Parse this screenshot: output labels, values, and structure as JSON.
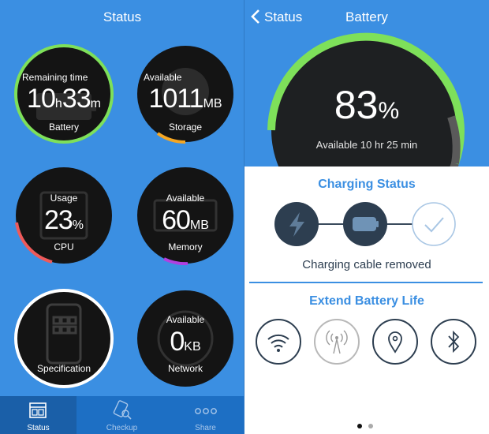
{
  "left_title": "Status",
  "nav": {
    "back_label": "Status",
    "title": "Battery"
  },
  "battery_tile": {
    "label": "Remaining time",
    "hours": "10",
    "h_unit": "h",
    "minutes": "33",
    "m_unit": "m",
    "name": "Battery"
  },
  "storage_tile": {
    "label": "Available",
    "value": "1011",
    "unit": "MB",
    "name": "Storage"
  },
  "cpu_tile": {
    "label": "Usage",
    "value": "23",
    "unit": "%",
    "name": "CPU"
  },
  "memory_tile": {
    "label": "Available",
    "value": "60",
    "unit": "MB",
    "name": "Memory"
  },
  "spec_tile": {
    "name": "Specification"
  },
  "network_tile": {
    "label": "Available",
    "value": "0",
    "unit": "KB",
    "name": "Network"
  },
  "tabs": [
    {
      "label": "Status",
      "icon": "status-icon"
    },
    {
      "label": "Checkup",
      "icon": "checkup-icon"
    },
    {
      "label": "Share",
      "icon": "share-icon"
    }
  ],
  "battery_big": {
    "percent": "83",
    "unit": "%",
    "available": "Available 10 hr 25 min",
    "level": 0.83
  },
  "charging": {
    "title": "Charging Status",
    "status": "Charging cable removed"
  },
  "extend": {
    "title": "Extend Battery Life",
    "icons": [
      "wifi-icon",
      "cellular-icon",
      "location-icon",
      "bluetooth-icon"
    ]
  },
  "colors": {
    "accent": "#3b8fe2",
    "green": "#7ee05a",
    "orange": "#f5a623",
    "red": "#ef5a5a",
    "purple": "#b040e0",
    "dark": "#1c1c1e"
  }
}
